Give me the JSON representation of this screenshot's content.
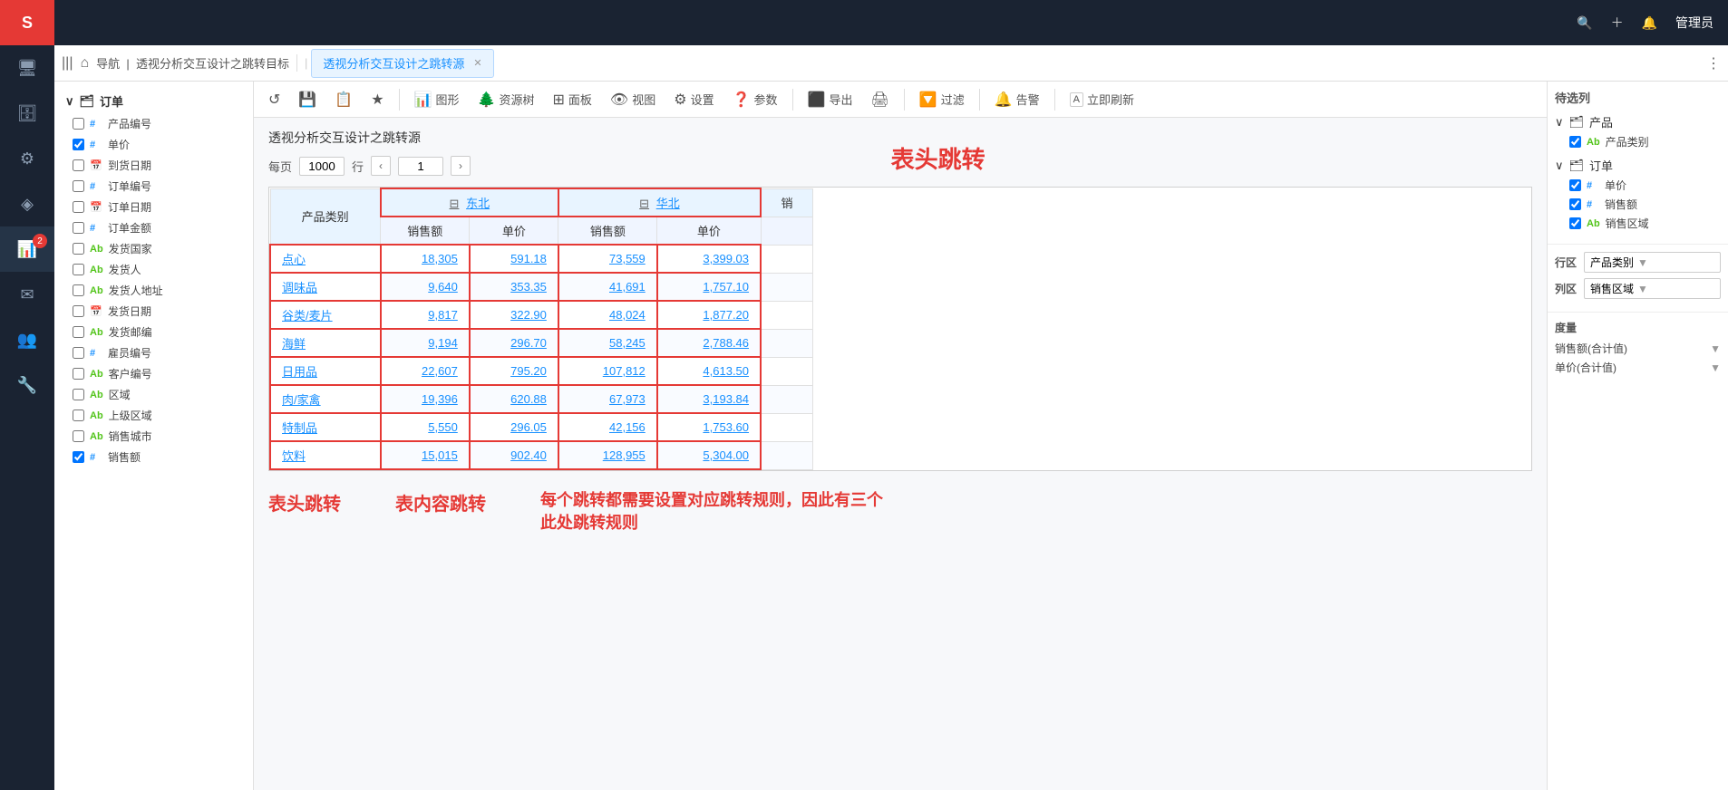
{
  "app": {
    "logo": "S",
    "admin": "管理员"
  },
  "sidebar": {
    "icons": [
      {
        "name": "monitor-icon",
        "symbol": "🖥",
        "active": false
      },
      {
        "name": "database-icon",
        "symbol": "🗄",
        "active": false
      },
      {
        "name": "settings-gear-icon",
        "symbol": "⚙",
        "active": false
      },
      {
        "name": "cube-icon",
        "symbol": "◈",
        "active": false
      },
      {
        "name": "chart-icon",
        "symbol": "📊",
        "active": true,
        "badge": "2"
      },
      {
        "name": "send-icon",
        "symbol": "✉",
        "active": false
      },
      {
        "name": "user-group-icon",
        "symbol": "👥",
        "active": false
      },
      {
        "name": "tools-icon",
        "symbol": "🔧",
        "active": false
      }
    ]
  },
  "tabbar": {
    "nav_icon": "|||",
    "home_icon": "⌂",
    "breadcrumb": [
      "导航",
      "透视分析交互设计之跳转目标"
    ],
    "tabs": [
      {
        "label": "透视分析交互设计之跳转源",
        "active": true,
        "closable": true
      }
    ],
    "separator": "|",
    "more_icon": "⋮"
  },
  "fields": {
    "section_label": "订单",
    "items": [
      {
        "checked": false,
        "type": "#",
        "label": "产品编号"
      },
      {
        "checked": true,
        "type": "#",
        "label": "单价"
      },
      {
        "checked": false,
        "type": "📅",
        "label": "到货日期"
      },
      {
        "checked": false,
        "type": "#",
        "label": "订单编号"
      },
      {
        "checked": false,
        "type": "📅",
        "label": "订单日期"
      },
      {
        "checked": false,
        "type": "#",
        "label": "订单金额"
      },
      {
        "checked": false,
        "type": "Ab",
        "label": "发货国家"
      },
      {
        "checked": false,
        "type": "Ab",
        "label": "发货人"
      },
      {
        "checked": false,
        "type": "Ab",
        "label": "发货人地址"
      },
      {
        "checked": false,
        "type": "📅",
        "label": "发货日期"
      },
      {
        "checked": false,
        "type": "Ab",
        "label": "发货邮编"
      },
      {
        "checked": false,
        "type": "#",
        "label": "雇员编号"
      },
      {
        "checked": false,
        "type": "Ab",
        "label": "客户编号"
      },
      {
        "checked": false,
        "type": "Ab",
        "label": "区域"
      },
      {
        "checked": false,
        "type": "Ab",
        "label": "上级区域"
      },
      {
        "checked": false,
        "type": "Ab",
        "label": "销售城市"
      },
      {
        "checked": true,
        "type": "#",
        "label": "销售额"
      }
    ]
  },
  "toolbar": {
    "buttons": [
      {
        "icon": "↺",
        "label": ""
      },
      {
        "icon": "💾",
        "label": ""
      },
      {
        "icon": "📋",
        "label": ""
      },
      {
        "icon": "★",
        "label": ""
      },
      {
        "icon": "📊",
        "label": "图形"
      },
      {
        "icon": "🌲",
        "label": "资源树"
      },
      {
        "icon": "⊞",
        "label": "面板"
      },
      {
        "icon": "👁",
        "label": "视图"
      },
      {
        "icon": "⚙",
        "label": "设置"
      },
      {
        "icon": "❓",
        "label": "参数"
      },
      {
        "icon": "⬛",
        "label": "导出"
      },
      {
        "icon": "🖨",
        "label": ""
      },
      {
        "icon": "🔽",
        "label": "过滤"
      },
      {
        "icon": "🔔",
        "label": "告警"
      },
      {
        "icon": "A",
        "label": "立即刷新"
      }
    ]
  },
  "report": {
    "title": "透视分析交互设计之跳转源",
    "pagination": {
      "rows_per_page_label": "每页",
      "rows_per_page": "1000",
      "rows_unit": "行",
      "current_page": "1"
    },
    "table": {
      "row_header": "产品类别",
      "regions": [
        {
          "name": "东北",
          "col1_header": "销售额",
          "col2_header": "单价"
        },
        {
          "name": "华北",
          "col1_header": "销售额",
          "col2_header": "单价"
        }
      ],
      "rows": [
        {
          "category": "点心",
          "dongbei_sales": "18,305",
          "dongbei_price": "591.18",
          "huabei_sales": "73,559",
          "huabei_price": "3,399.03"
        },
        {
          "category": "调味品",
          "dongbei_sales": "9,640",
          "dongbei_price": "353.35",
          "huabei_sales": "41,691",
          "huabei_price": "1,757.10"
        },
        {
          "category": "谷类/麦片",
          "dongbei_sales": "9,817",
          "dongbei_price": "322.90",
          "huabei_sales": "48,024",
          "huabei_price": "1,877.20"
        },
        {
          "category": "海鲜",
          "dongbei_sales": "9,194",
          "dongbei_price": "296.70",
          "huabei_sales": "58,245",
          "huabei_price": "2,788.46"
        },
        {
          "category": "日用品",
          "dongbei_sales": "22,607",
          "dongbei_price": "795.20",
          "huabei_sales": "107,812",
          "huabei_price": "4,613.50"
        },
        {
          "category": "肉/家禽",
          "dongbei_sales": "19,396",
          "dongbei_price": "620.88",
          "huabei_sales": "67,973",
          "huabei_price": "3,193.84"
        },
        {
          "category": "特制品",
          "dongbei_sales": "5,550",
          "dongbei_price": "296.05",
          "huabei_sales": "42,156",
          "huabei_price": "1,753.60"
        },
        {
          "category": "饮料",
          "dongbei_sales": "15,015",
          "dongbei_price": "902.40",
          "huabei_sales": "128,955",
          "huabei_price": "5,304.00"
        }
      ],
      "extra_col_header": "销"
    }
  },
  "right_panel": {
    "pending_list_title": "待选列",
    "product_section": {
      "label": "产品",
      "fields": [
        {
          "checked": true,
          "type": "Ab",
          "label": "产品类别"
        }
      ]
    },
    "order_section": {
      "label": "订单",
      "fields": [
        {
          "checked": true,
          "type": "#",
          "label": "单价"
        },
        {
          "checked": true,
          "type": "#",
          "label": "销售额"
        },
        {
          "checked": true,
          "type": "Ab",
          "label": "销售区域"
        }
      ]
    },
    "row_zone": {
      "label": "行区",
      "value": "产品类别"
    },
    "col_zone": {
      "label": "列区",
      "value": "销售区域"
    },
    "measures": {
      "label": "度量",
      "items": [
        {
          "label": "销售额(合计值)"
        },
        {
          "label": "单价(合计值)"
        }
      ]
    }
  },
  "annotations": {
    "header_jump": "表头跳转",
    "header_jump2": "表头跳转",
    "content_jump": "表内容跳转",
    "right_note": "每个跳转都需要设置对应跳转规则，因此有三个此处跳转规则"
  }
}
